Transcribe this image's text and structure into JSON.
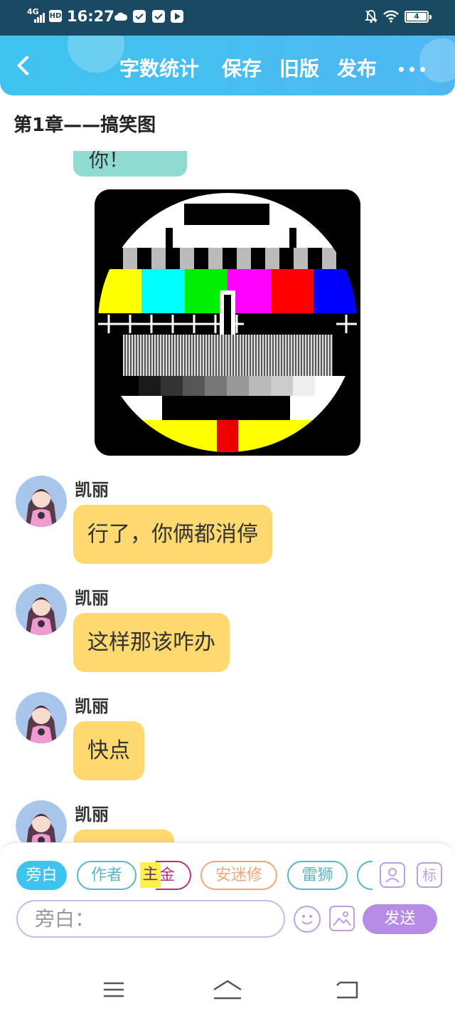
{
  "status_bar": {
    "network": "4G",
    "hd": "HD",
    "time": "16:27",
    "battery": "4",
    "icons": [
      "signal-icon",
      "cloud-icon",
      "message-icon",
      "message-icon",
      "play-icon",
      "bell-off-icon",
      "wifi-icon",
      "battery-icon"
    ]
  },
  "header": {
    "back_icon": "back-arrow-icon",
    "word_count": "字数统计",
    "save": "保存",
    "old_version": "旧版",
    "publish": "发布",
    "more_icon": "more-dots-icon",
    "colors": {
      "gradient_start": "#3ec3ef",
      "gradient_end": "#4fb8f2"
    }
  },
  "chapter_title": "第1章——搞笑图",
  "partial_bubble": {
    "text": "你！",
    "color": "#8fdbd2"
  },
  "image": {
    "description_icon": "tv-test-card-image"
  },
  "messages": [
    {
      "sender": "凯丽",
      "text": "行了，你俩都消停"
    },
    {
      "sender": "凯丽",
      "text": "这样那该咋办"
    },
    {
      "sender": "凯丽",
      "text": "快点"
    },
    {
      "sender": "凯丽",
      "text": ""
    }
  ],
  "bubble_color": "#fed970",
  "characters": [
    {
      "label": "旁白",
      "active": true,
      "color": "#3ec3ef"
    },
    {
      "label": "作者",
      "active": false,
      "color": "#5ab5c9"
    },
    {
      "label_highlight": "主",
      "label_rest": "金",
      "active": false,
      "color": "#b8307c"
    },
    {
      "label": "安迷修",
      "active": false,
      "color": "#f0a67a"
    },
    {
      "label": "雷狮",
      "active": false,
      "color": "#5ab5c9"
    }
  ],
  "side_icons": {
    "role": "person-card-icon",
    "mark": "标"
  },
  "input": {
    "placeholder": "旁白："
  },
  "toolbar": {
    "emoji_icon": "emoji-icon",
    "image_icon": "image-icon",
    "send": "发送",
    "accent": "#b68ce6"
  },
  "navbar": {
    "icons": [
      "menu-icon",
      "home-icon",
      "back-icon"
    ]
  }
}
